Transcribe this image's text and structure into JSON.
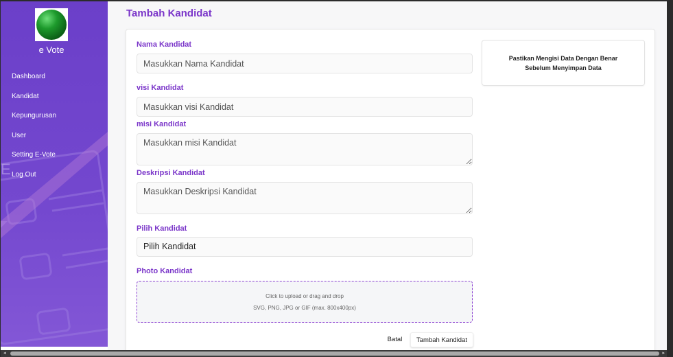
{
  "app": {
    "brand": "e Vote",
    "logo_icon": "green-globe-logo"
  },
  "sidebar": {
    "items": [
      {
        "label": "Dashboard"
      },
      {
        "label": "Kandidat"
      },
      {
        "label": "Kepungurusan"
      },
      {
        "label": "User"
      },
      {
        "label": "Setting E-Vote"
      },
      {
        "label": "Log Out"
      }
    ]
  },
  "page": {
    "title": "Tambah Kandidat"
  },
  "form": {
    "nama": {
      "label": "Nama Kandidat",
      "placeholder": "Masukkan Nama Kandidat"
    },
    "visi": {
      "label": "visi Kandidat",
      "placeholder": "Masukkan visi Kandidat"
    },
    "misi": {
      "label": "misi Kandidat",
      "placeholder": "Masukkan misi Kandidat"
    },
    "deskripsi": {
      "label": "Deskripsi Kandidat",
      "placeholder": "Masukkan Deskripsi Kandidat"
    },
    "pilih": {
      "label": "Pilih Kandidat",
      "value": "Pilih Kandidat"
    },
    "photo": {
      "label": "Photo Kandidat",
      "line1": "Click to upload or drag and drop",
      "line2": "SVG, PNG, JPG or GIF (max. 800x400px)"
    },
    "cancel_label": "Batal",
    "submit_label": "Tambah Kandidat"
  },
  "notice": {
    "line1": "Pastikan Mengisi Data Dengan Benar",
    "line2": "Sebelum Menyimpan Data"
  },
  "colors": {
    "accent": "#7a35c9",
    "sidebar": "#6b3fc9",
    "dropzone_border": "#8a3ed1"
  },
  "scrollbar": {
    "left_arrow": "◂",
    "right_arrow": "▸"
  }
}
